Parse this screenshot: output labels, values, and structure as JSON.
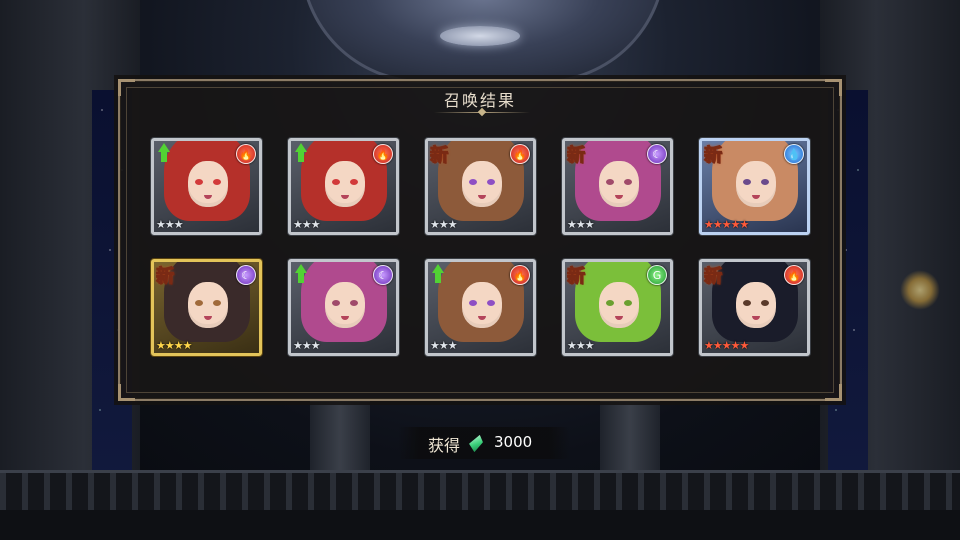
{
  "dialog": {
    "title": "召唤结果"
  },
  "results": [
    {
      "new": false,
      "upgrade": true,
      "element": "fire",
      "element_glyph": "🔥",
      "rarity": 3,
      "frame": "silver",
      "hair": "#b5302a",
      "eye": "#d23a3a"
    },
    {
      "new": false,
      "upgrade": true,
      "element": "fire",
      "element_glyph": "🔥",
      "rarity": 3,
      "frame": "silver",
      "hair": "#b5302a",
      "eye": "#d23a3a"
    },
    {
      "new": true,
      "upgrade": false,
      "element": "fire",
      "element_glyph": "🔥",
      "rarity": 3,
      "frame": "silver",
      "hair": "#8d5a3a",
      "eye": "#8e4fc4"
    },
    {
      "new": true,
      "upgrade": false,
      "element": "dark",
      "element_glyph": "☾",
      "rarity": 3,
      "frame": "silver",
      "hair": "#b04a8e",
      "eye": "#a04a6a"
    },
    {
      "new": true,
      "upgrade": false,
      "element": "water",
      "element_glyph": "💧",
      "rarity": 5,
      "frame": "blue",
      "hair": "#c98a64",
      "eye": "#6a4a8c"
    },
    {
      "new": true,
      "upgrade": false,
      "element": "dark",
      "element_glyph": "☾",
      "rarity": 4,
      "frame": "gold",
      "hair": "#3a2a2a",
      "eye": "#a06a3a"
    },
    {
      "new": false,
      "upgrade": true,
      "element": "dark",
      "element_glyph": "☾",
      "rarity": 3,
      "frame": "silver",
      "hair": "#b04a8e",
      "eye": "#a04a6a"
    },
    {
      "new": false,
      "upgrade": true,
      "element": "fire",
      "element_glyph": "🔥",
      "rarity": 3,
      "frame": "silver",
      "hair": "#8d5a3a",
      "eye": "#8e4fc4"
    },
    {
      "new": true,
      "upgrade": false,
      "element": "wind",
      "element_glyph": "G",
      "rarity": 3,
      "frame": "silver",
      "hair": "#7bbf3a",
      "eye": "#6aa030"
    },
    {
      "new": true,
      "upgrade": false,
      "element": "fire",
      "element_glyph": "🔥",
      "rarity": 5,
      "frame": "silver",
      "hair": "#1a1c2a",
      "eye": "#5a3a2a"
    }
  ],
  "new_label": "新",
  "reward": {
    "label": "获得",
    "icon": "crystal-icon",
    "amount": "3000"
  },
  "colors": {
    "frame_border": "#8c7c66",
    "title": "#e6dccb"
  }
}
